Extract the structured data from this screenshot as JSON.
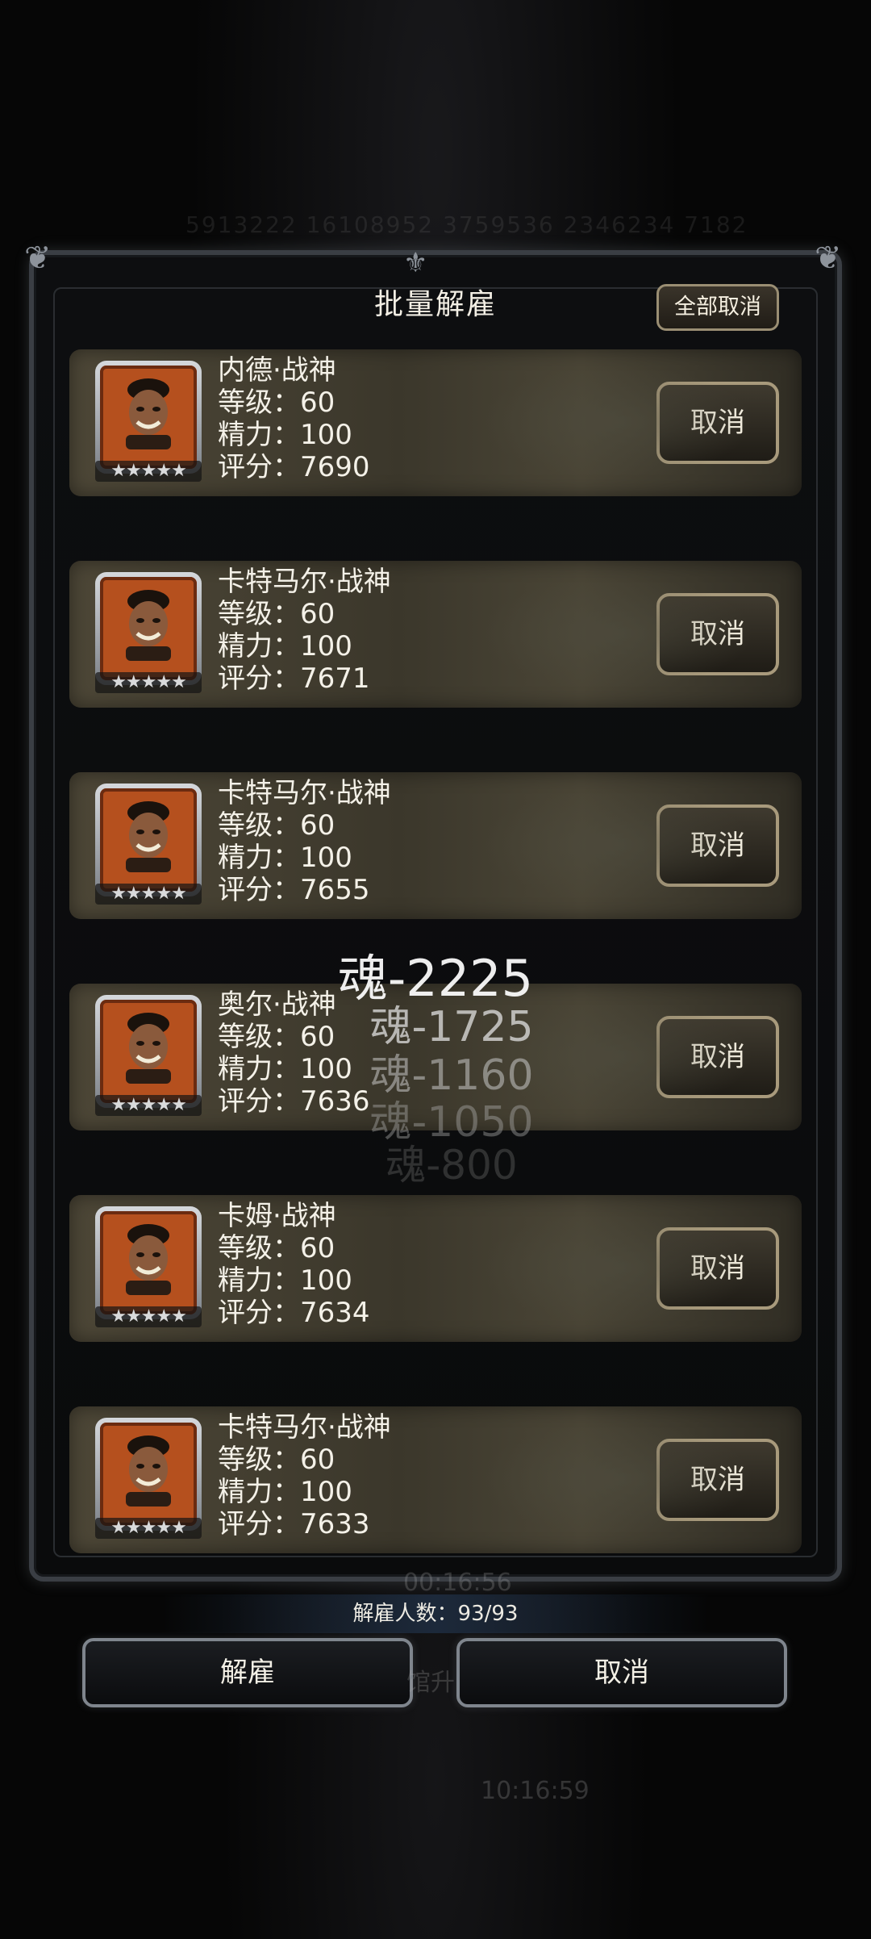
{
  "dialog": {
    "title": "批量解雇",
    "cancel_all_label": "全部取消",
    "count_label": "解雇人数：93/93",
    "confirm_label": "解雇",
    "close_label": "取消"
  },
  "background": {
    "numbers_text": "5913222 16108952 3759536 2346234 7182",
    "timer_text_1": "00:16:56",
    "timer_text_2": "10:16:59",
    "partial_text": "馆升"
  },
  "items": [
    {
      "name": "内德·战神",
      "level": "等级：60",
      "energy": "精力：100",
      "score": "评分：7690",
      "stars": "★★★★★",
      "action_label": "取消"
    },
    {
      "name": "卡特马尔·战神",
      "level": "等级：60",
      "energy": "精力：100",
      "score": "评分：7671",
      "stars": "★★★★★",
      "action_label": "取消"
    },
    {
      "name": "卡特马尔·战神",
      "level": "等级：60",
      "energy": "精力：100",
      "score": "评分：7655",
      "stars": "★★★★★",
      "action_label": "取消"
    },
    {
      "name": "奥尔·战神",
      "level": "等级：60",
      "energy": "精力：100",
      "score": "评分：7636",
      "stars": "★★★★★",
      "action_label": "取消"
    },
    {
      "name": "卡姆·战神",
      "level": "等级：60",
      "energy": "精力：100",
      "score": "评分：7634",
      "stars": "★★★★★",
      "action_label": "取消"
    },
    {
      "name": "卡特马尔·战神",
      "level": "等级：60",
      "energy": "精力：100",
      "score": "评分：7633",
      "stars": "★★★★★",
      "action_label": "取消"
    }
  ],
  "soul_popups": [
    "魂-2225",
    "魂-1725",
    "魂-1160",
    "魂-1050",
    "魂-800"
  ],
  "colors": {
    "portrait_bg": "#b5501e",
    "card_bg": "#4d4737",
    "button_border": "#a89a7c"
  }
}
